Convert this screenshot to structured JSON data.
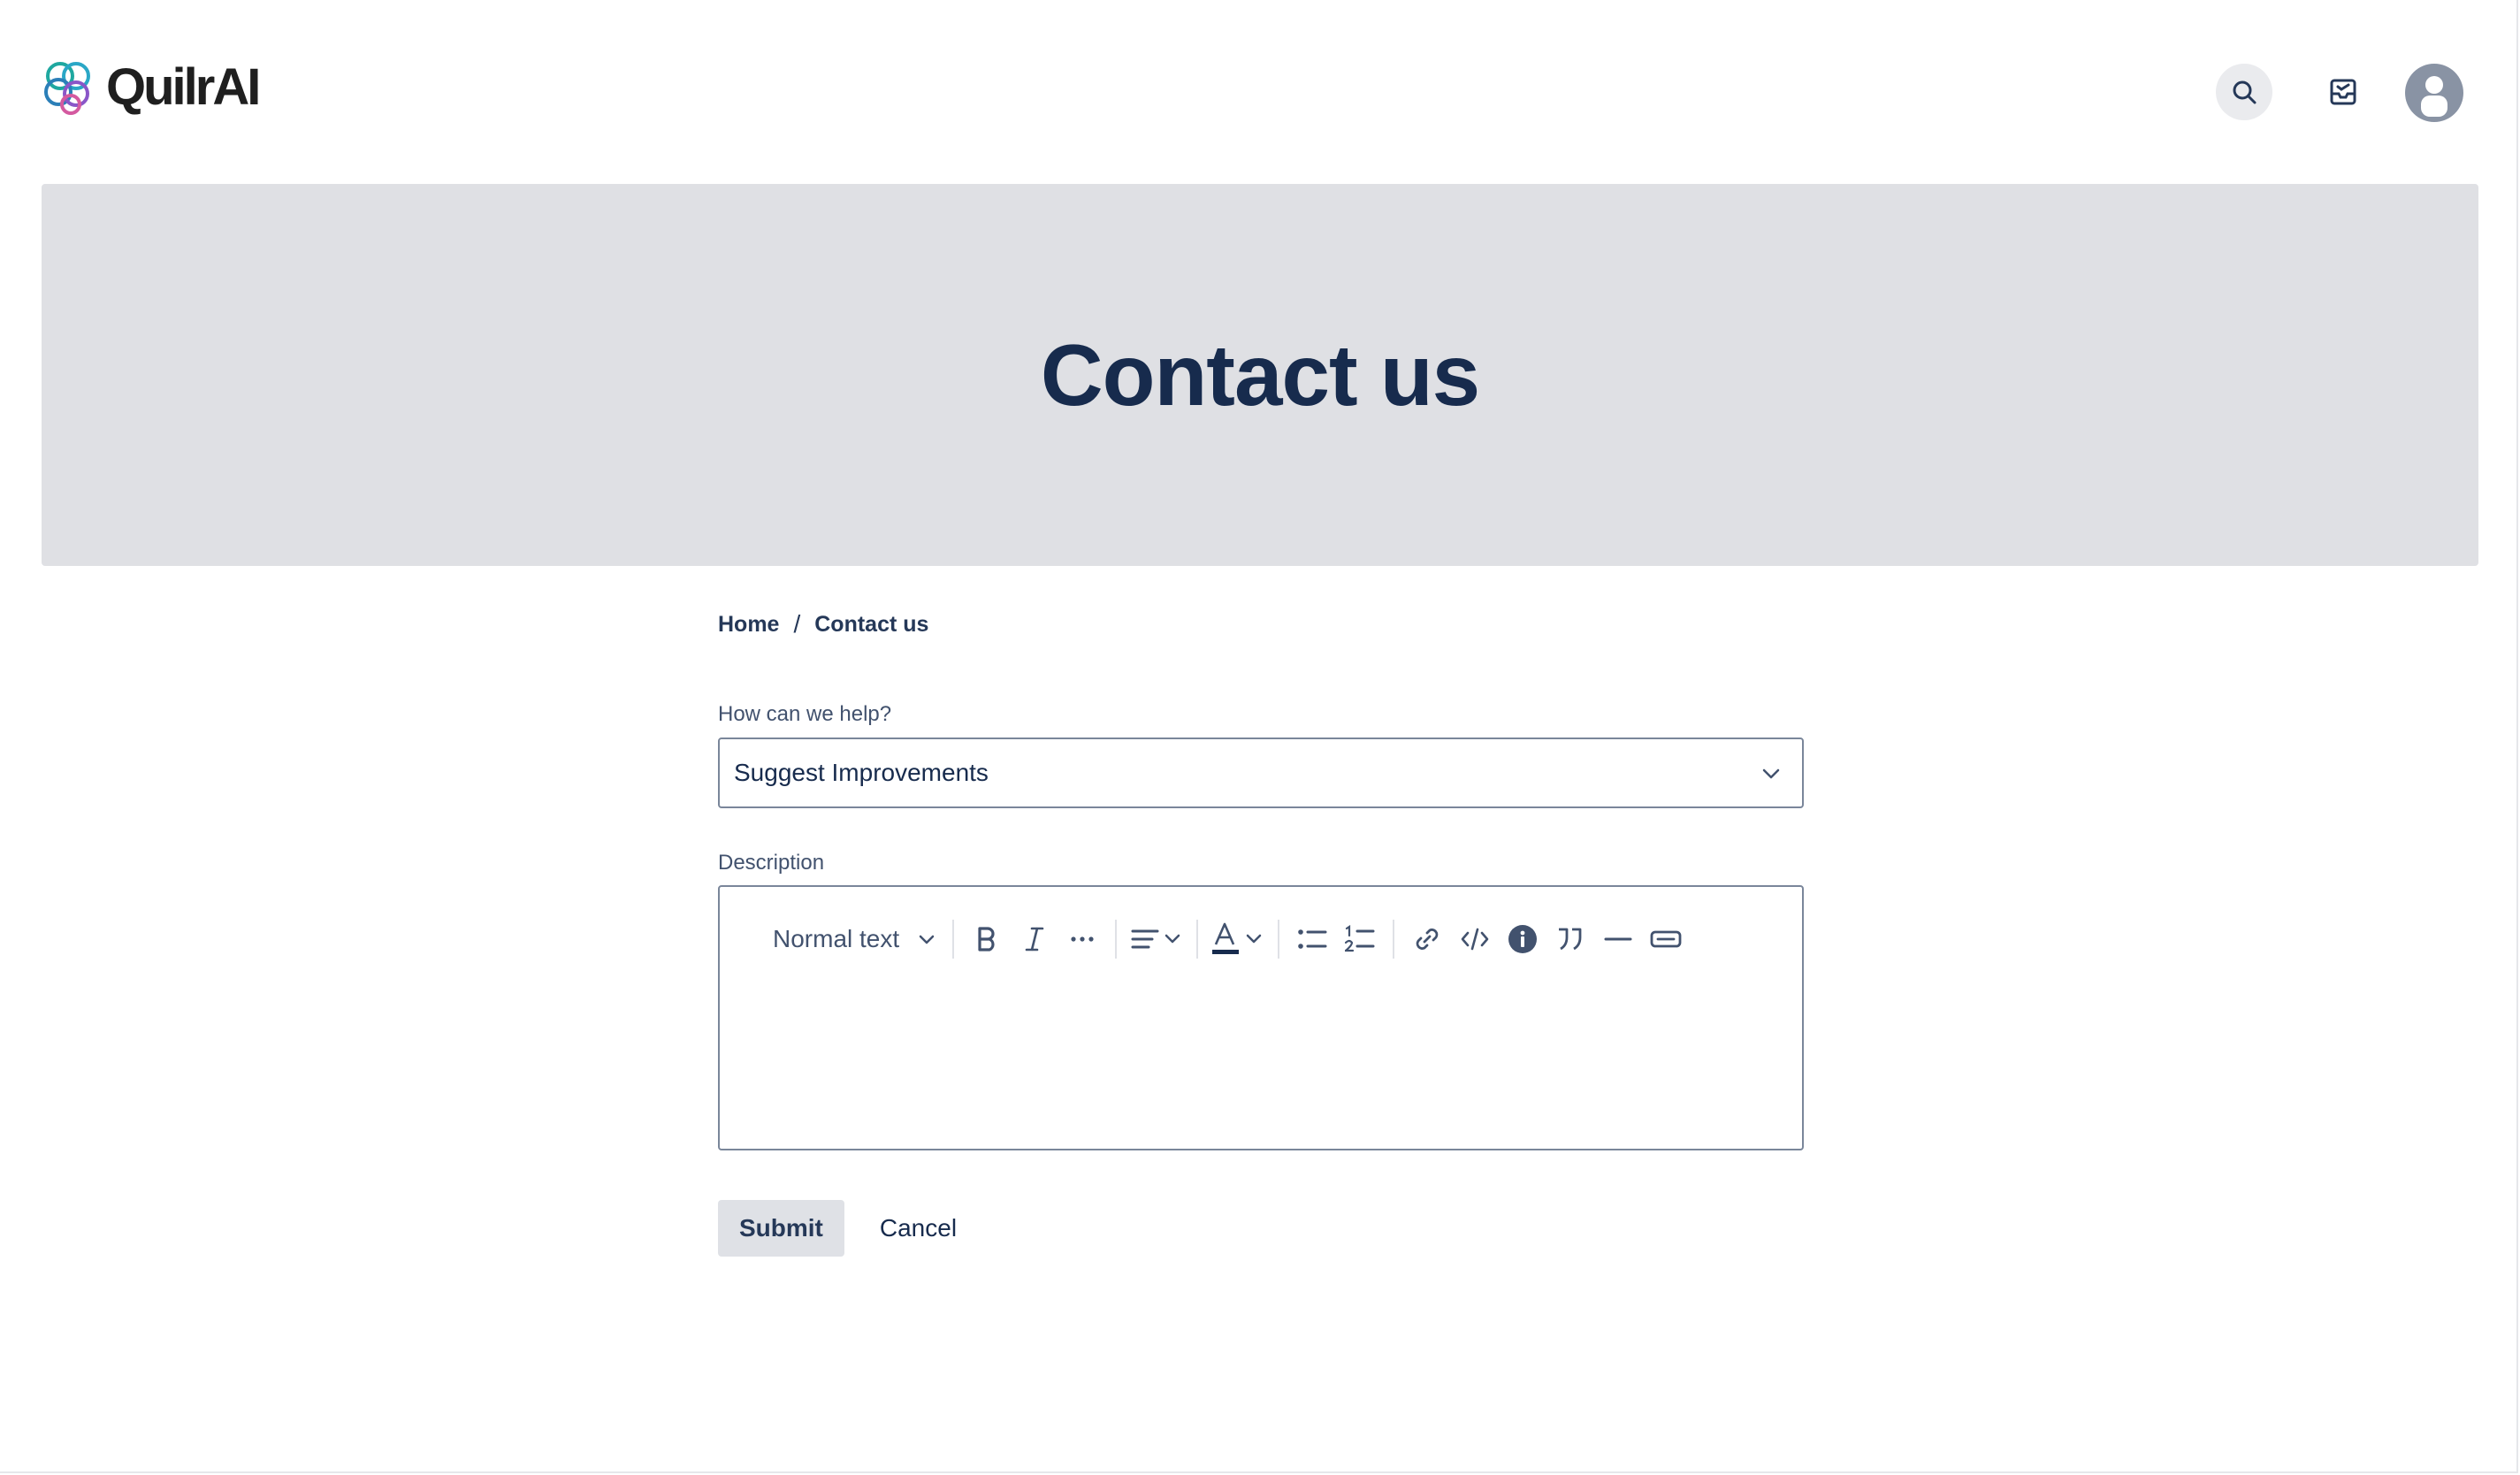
{
  "header": {
    "logo_text": "QuilrAI",
    "icons": [
      "logo-icon",
      "search-icon",
      "notifications-icon",
      "avatar-icon"
    ]
  },
  "banner": {
    "title": "Contact us"
  },
  "breadcrumb": {
    "home": "Home",
    "separator": "/",
    "current": "Contact us"
  },
  "form": {
    "help_label": "How can we help?",
    "help_value": "Suggest Improvements",
    "description_label": "Description",
    "editor": {
      "text_style": "Normal text",
      "tools": [
        "bold-icon",
        "italic-icon",
        "more-formatting-icon",
        "align-icon",
        "text-color-icon",
        "bullet-list-icon",
        "numbered-list-icon",
        "link-icon",
        "code-icon",
        "info-panel-icon",
        "quote-icon",
        "divider-icon",
        "expand-icon"
      ]
    },
    "submit_label": "Submit",
    "cancel_label": "Cancel"
  },
  "colors": {
    "heading": "#172b4d",
    "banner_bg": "#dfe0e4",
    "border": "#7a869a",
    "avatar_bg": "#8993a4"
  }
}
